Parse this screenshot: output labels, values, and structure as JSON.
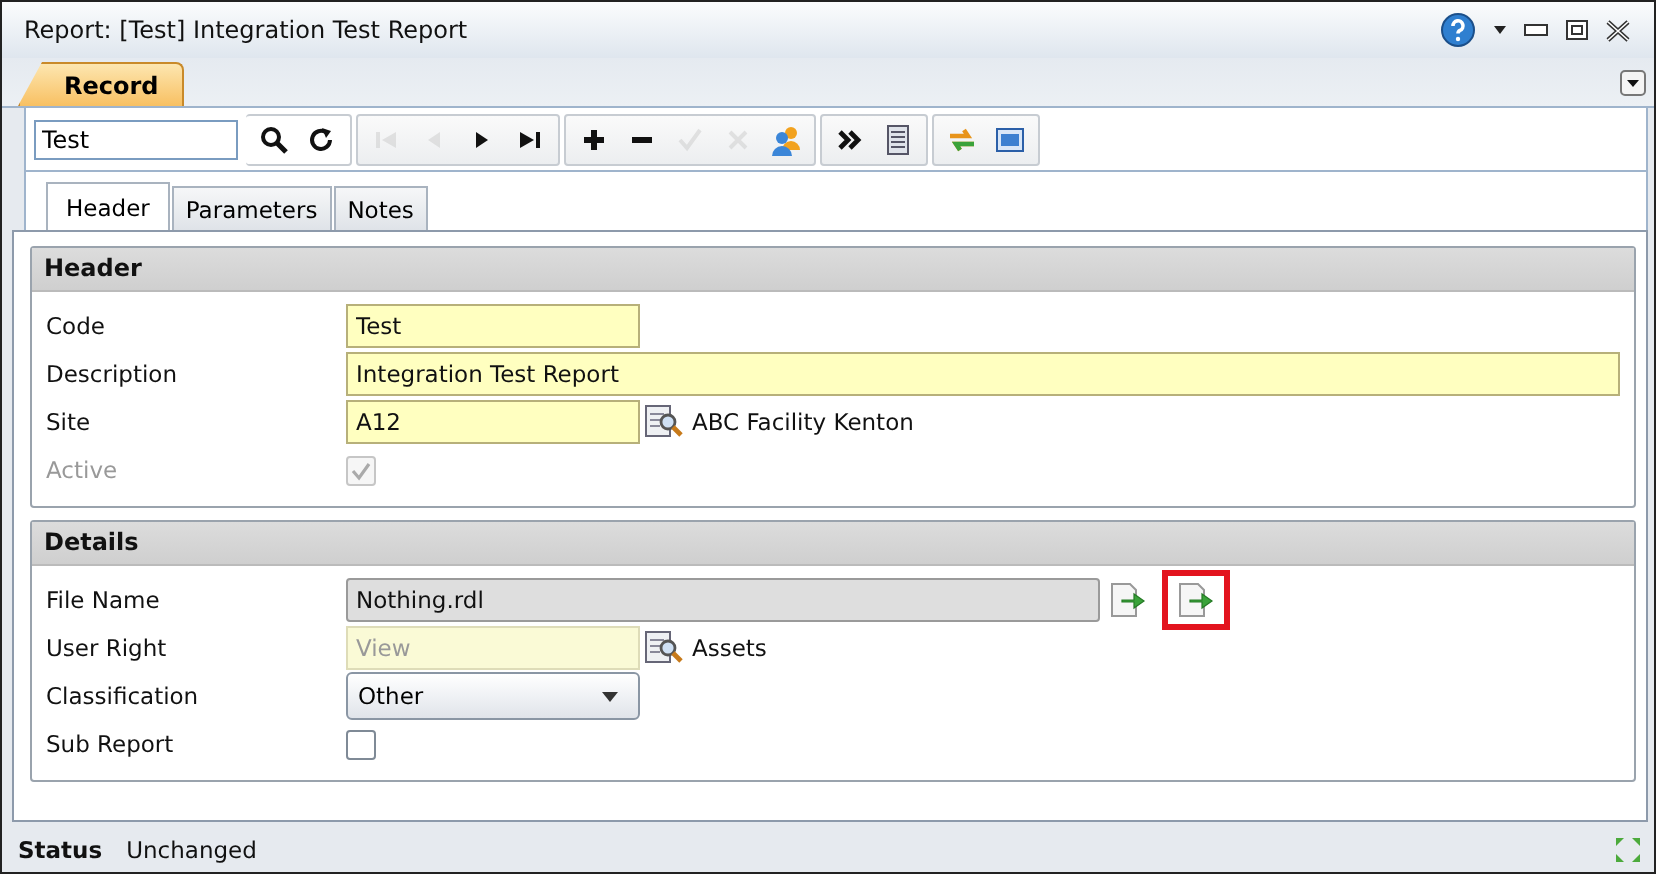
{
  "window": {
    "title": "Report: [Test] Integration Test Report"
  },
  "ribbon_tabs": [
    {
      "label": "Record",
      "selected": true
    }
  ],
  "toolbar": {
    "search": {
      "value": "Test"
    },
    "groups": [
      [
        {
          "kind": "search",
          "disabled": false
        },
        {
          "kind": "refresh",
          "disabled": false
        }
      ],
      [
        {
          "kind": "first",
          "disabled": true
        },
        {
          "kind": "prev",
          "disabled": true
        },
        {
          "kind": "next",
          "disabled": false
        },
        {
          "kind": "last",
          "disabled": false
        }
      ],
      [
        {
          "kind": "add",
          "disabled": false
        },
        {
          "kind": "remove",
          "disabled": false
        },
        {
          "kind": "accept",
          "disabled": true
        },
        {
          "kind": "cancel",
          "disabled": true
        },
        {
          "kind": "users",
          "disabled": false
        }
      ],
      [
        {
          "kind": "more",
          "disabled": false
        },
        {
          "kind": "list",
          "disabled": false
        }
      ],
      [
        {
          "kind": "sync",
          "disabled": false
        },
        {
          "kind": "window",
          "disabled": false
        }
      ]
    ]
  },
  "tabs": [
    {
      "label": "Header",
      "selected": true
    },
    {
      "label": "Parameters",
      "selected": false
    },
    {
      "label": "Notes",
      "selected": false
    }
  ],
  "sections": [
    {
      "title": "Header",
      "fields": [
        {
          "kind": "text",
          "label": "Code",
          "value": "Test"
        },
        {
          "kind": "wide_text",
          "label": "Description",
          "value": "Integration Test Report"
        },
        {
          "kind": "lookup",
          "label": "Site",
          "value": "A12",
          "lookup_text": "ABC Facility Kenton",
          "disabled": false
        },
        {
          "kind": "checkbox",
          "label": "Active",
          "checked": true,
          "disabled": true
        }
      ]
    },
    {
      "title": "Details",
      "fields": [
        {
          "kind": "file",
          "label": "File Name",
          "value": "Nothing.rdl",
          "buttons": [
            {
              "highlighted": false
            },
            {
              "highlighted": true
            }
          ]
        },
        {
          "kind": "lookup",
          "label": "User Right",
          "placeholder": "View",
          "lookup_text": "Assets",
          "disabled": true
        },
        {
          "kind": "select",
          "label": "Classification",
          "value": "Other"
        },
        {
          "kind": "checkbox",
          "label": "Sub Report",
          "checked": false,
          "disabled": false
        }
      ]
    }
  ],
  "status_bar": {
    "label": "Status",
    "value": "Unchanged"
  }
}
